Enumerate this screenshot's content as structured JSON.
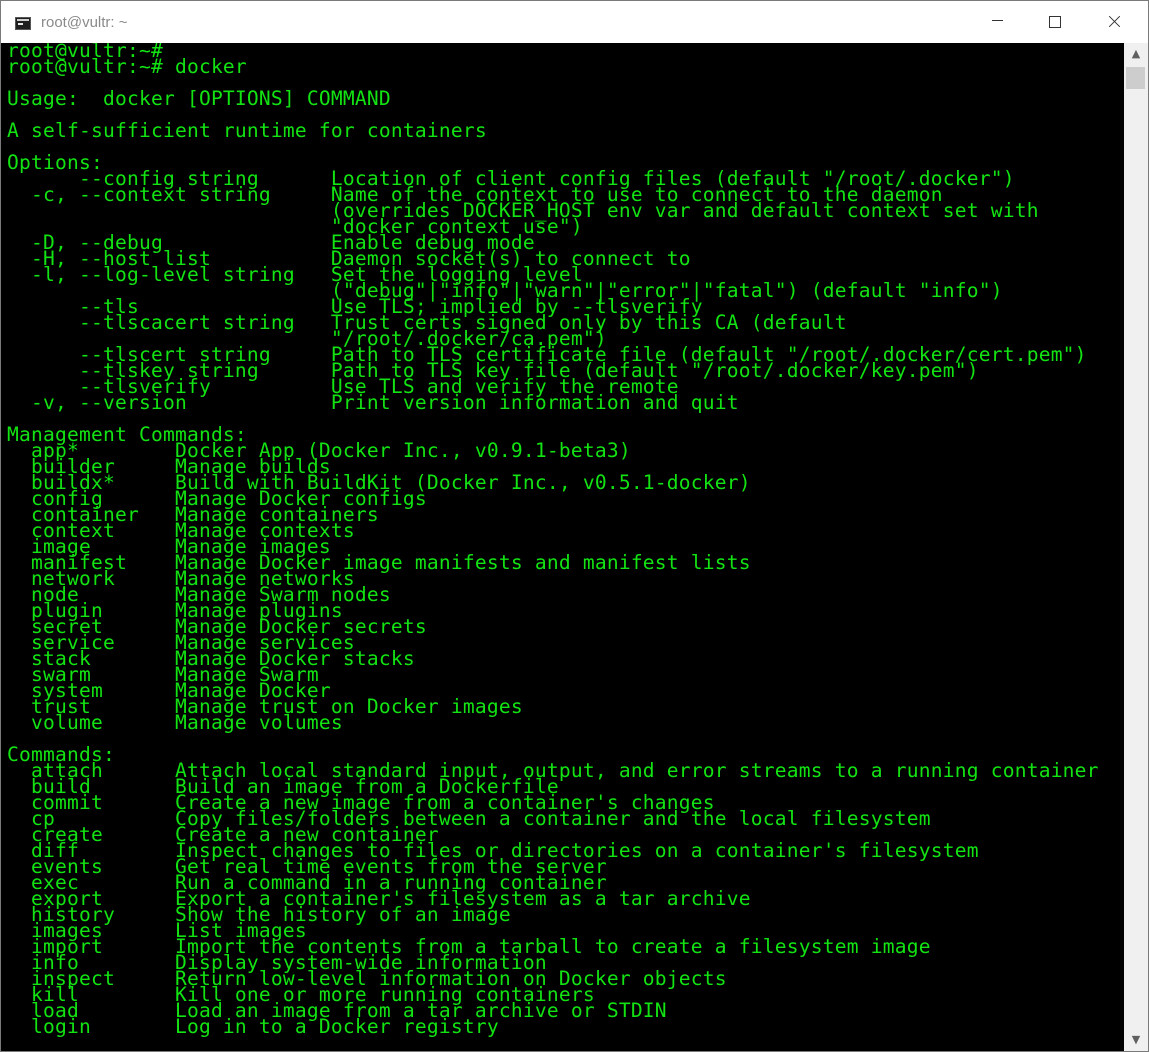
{
  "window": {
    "title": "root@vultr: ~",
    "minimize_icon": "minimize-icon",
    "maximize_icon": "maximize-icon",
    "close_icon": "close-icon"
  },
  "colors": {
    "terminal_bg": "#000000",
    "terminal_fg": "#13e313",
    "scrollbar_bg": "#f0f0f0",
    "scrollbar_thumb": "#cdcdcd"
  },
  "scrollbar": {
    "up_glyph": "▲",
    "down_glyph": "▼"
  },
  "terminal": {
    "lines": [
      "root@vultr:~#",
      "root@vultr:~# docker",
      "",
      "Usage:  docker [OPTIONS] COMMAND",
      "",
      "A self-sufficient runtime for containers",
      "",
      "Options:",
      "      --config string      Location of client config files (default \"/root/.docker\")",
      "  -c, --context string     Name of the context to use to connect to the daemon",
      "                           (overrides DOCKER_HOST env var and default context set with",
      "                           \"docker context use\")",
      "  -D, --debug              Enable debug mode",
      "  -H, --host list          Daemon socket(s) to connect to",
      "  -l, --log-level string   Set the logging level",
      "                           (\"debug\"|\"info\"|\"warn\"|\"error\"|\"fatal\") (default \"info\")",
      "      --tls                Use TLS; implied by --tlsverify",
      "      --tlscacert string   Trust certs signed only by this CA (default",
      "                           \"/root/.docker/ca.pem\")",
      "      --tlscert string     Path to TLS certificate file (default \"/root/.docker/cert.pem\")",
      "      --tlskey string      Path to TLS key file (default \"/root/.docker/key.pem\")",
      "      --tlsverify          Use TLS and verify the remote",
      "  -v, --version            Print version information and quit",
      "",
      "Management Commands:",
      "  app*        Docker App (Docker Inc., v0.9.1-beta3)",
      "  builder     Manage builds",
      "  buildx*     Build with BuildKit (Docker Inc., v0.5.1-docker)",
      "  config      Manage Docker configs",
      "  container   Manage containers",
      "  context     Manage contexts",
      "  image       Manage images",
      "  manifest    Manage Docker image manifests and manifest lists",
      "  network     Manage networks",
      "  node        Manage Swarm nodes",
      "  plugin      Manage plugins",
      "  secret      Manage Docker secrets",
      "  service     Manage services",
      "  stack       Manage Docker stacks",
      "  swarm       Manage Swarm",
      "  system      Manage Docker",
      "  trust       Manage trust on Docker images",
      "  volume      Manage volumes",
      "",
      "Commands:",
      "  attach      Attach local standard input, output, and error streams to a running container",
      "  build       Build an image from a Dockerfile",
      "  commit      Create a new image from a container's changes",
      "  cp          Copy files/folders between a container and the local filesystem",
      "  create      Create a new container",
      "  diff        Inspect changes to files or directories on a container's filesystem",
      "  events      Get real time events from the server",
      "  exec        Run a command in a running container",
      "  export      Export a container's filesystem as a tar archive",
      "  history     Show the history of an image",
      "  images      List images",
      "  import      Import the contents from a tarball to create a filesystem image",
      "  info        Display system-wide information",
      "  inspect     Return low-level information on Docker objects",
      "  kill        Kill one or more running containers",
      "  load        Load an image from a tar archive or STDIN",
      "  login       Log in to a Docker registry"
    ]
  }
}
